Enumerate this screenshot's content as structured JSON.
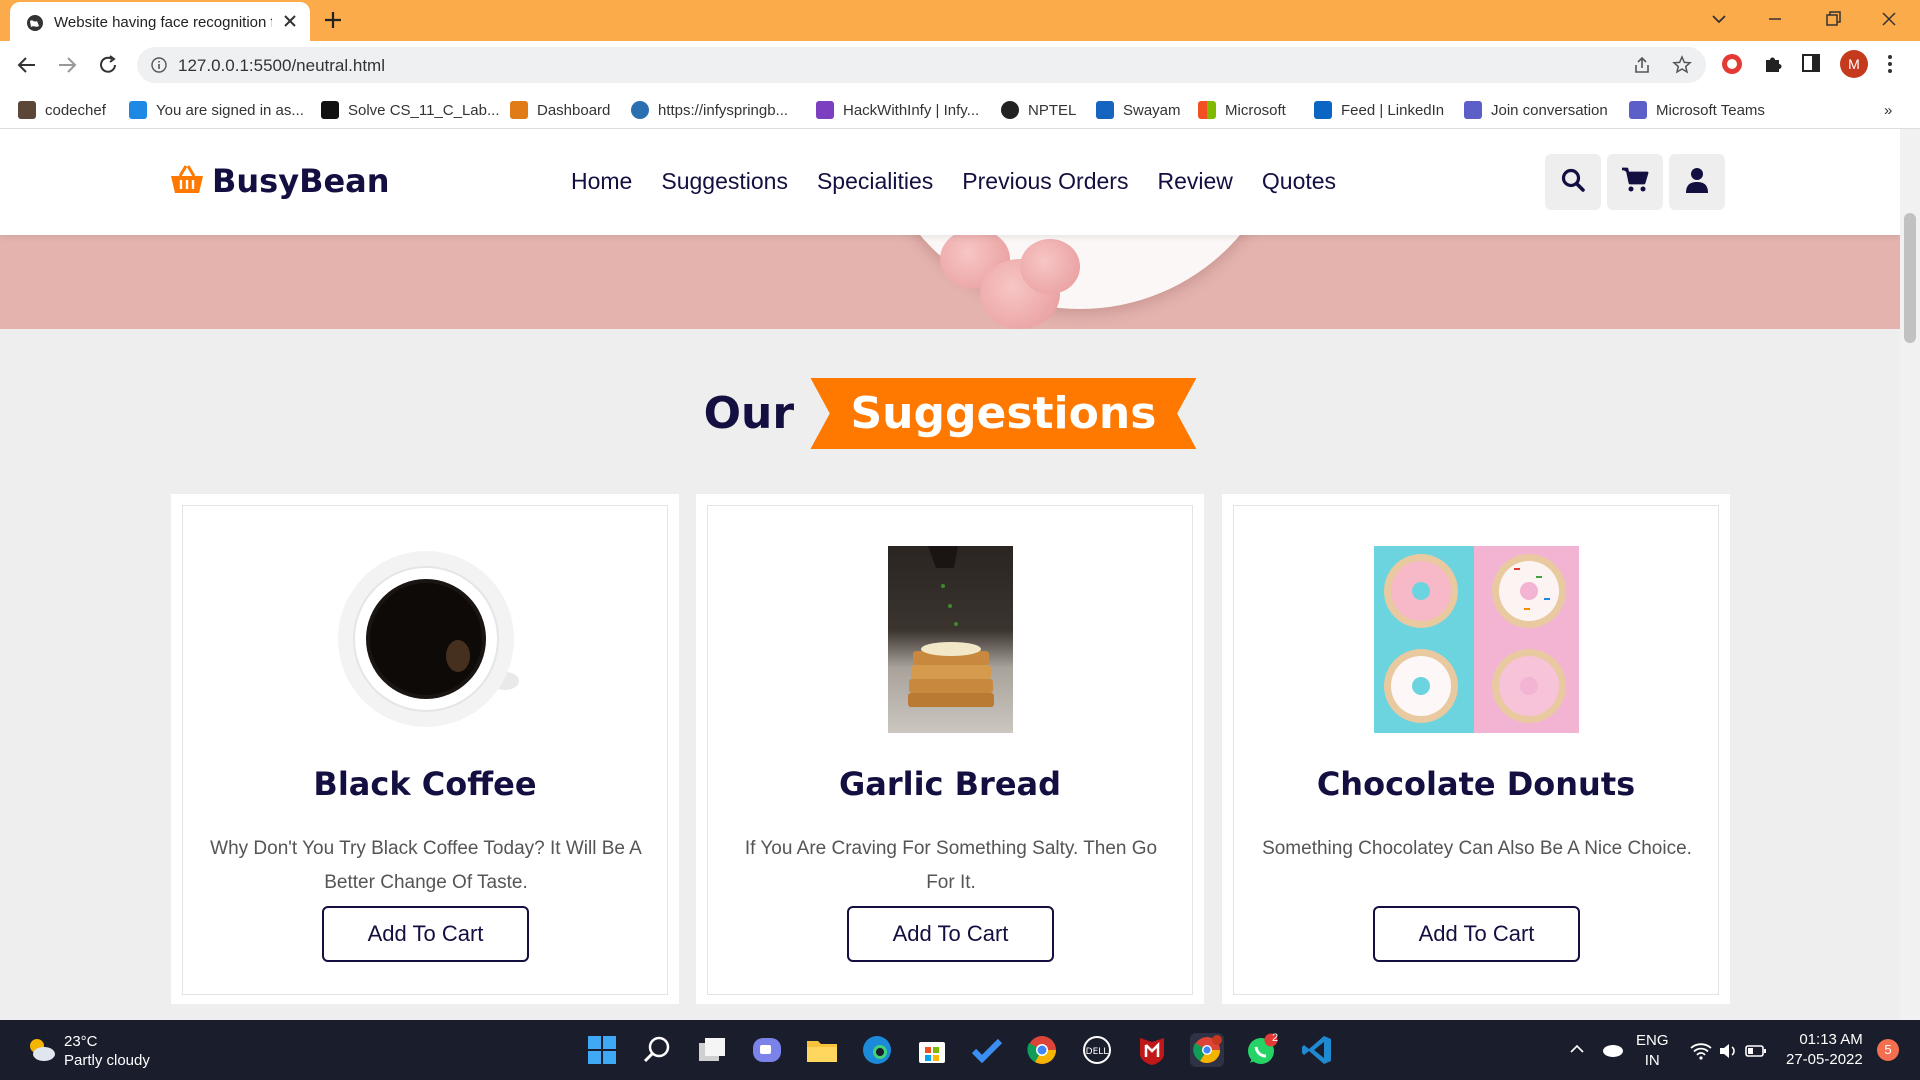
{
  "browser": {
    "tab_title": "Website having face recognition fe",
    "url": "127.0.0.1:5500/neutral.html",
    "profile_initial": "M",
    "bookmarks": [
      {
        "label": "codechef",
        "icon": "codechef-icon",
        "color": "#5b4638"
      },
      {
        "label": "You are signed in as...",
        "icon": "signin-icon",
        "color": "#1e88e5"
      },
      {
        "label": "Solve CS_11_C_Lab...",
        "icon": "hackerrank-icon",
        "color": "#111111"
      },
      {
        "label": "Dashboard",
        "icon": "dashboard-icon",
        "color": "#e07b16"
      },
      {
        "label": "https://infyspringb...",
        "icon": "infy-icon",
        "color": "#2a6fb0"
      },
      {
        "label": "HackWithInfy | Infy...",
        "icon": "hackwithinfy-icon",
        "color": "#7b3fbf"
      },
      {
        "label": "NPTEL",
        "icon": "nptel-icon",
        "color": "#222222"
      },
      {
        "label": "Swayam",
        "icon": "swayam-icon",
        "color": "#1565c0"
      },
      {
        "label": "Microsoft",
        "icon": "microsoft-icon",
        "color": "#f25022"
      },
      {
        "label": "Feed | LinkedIn",
        "icon": "linkedin-icon",
        "color": "#0a66c2"
      },
      {
        "label": "Join conversation",
        "icon": "teams-icon",
        "color": "#5b5fc7"
      },
      {
        "label": "Microsoft Teams",
        "icon": "teams-icon",
        "color": "#5b5fc7"
      }
    ],
    "more_bookmarks": "»"
  },
  "site": {
    "brand": "BusyBean",
    "brand_color": "#130f40",
    "accent": "#ff7800",
    "nav": [
      "Home",
      "Suggestions",
      "Specialities",
      "Previous Orders",
      "Review",
      "Quotes"
    ],
    "header_icons": [
      "search-icon",
      "cart-icon",
      "user-icon"
    ]
  },
  "section": {
    "heading_plain": "Our",
    "heading_badge": "Suggestions"
  },
  "products": [
    {
      "name": "Black Coffee",
      "description": "Why Don't You Try Black Coffee Today? It Will Be A Better Change Of Taste.",
      "button": "Add To Cart"
    },
    {
      "name": "Garlic Bread",
      "description": "If You Are Craving For Something Salty. Then Go For It.",
      "button": "Add To Cart"
    },
    {
      "name": "Chocolate Donuts",
      "description": "Something Chocolatey Can Also Be A Nice Choice.",
      "button": "Add To Cart"
    }
  ],
  "taskbar": {
    "temperature": "23°C",
    "weather": "Partly cloudy",
    "lang": "ENG",
    "region": "IN",
    "time": "01:13 AM",
    "date": "27-05-2022",
    "notifications": "5",
    "whatsapp_badge": "2"
  }
}
